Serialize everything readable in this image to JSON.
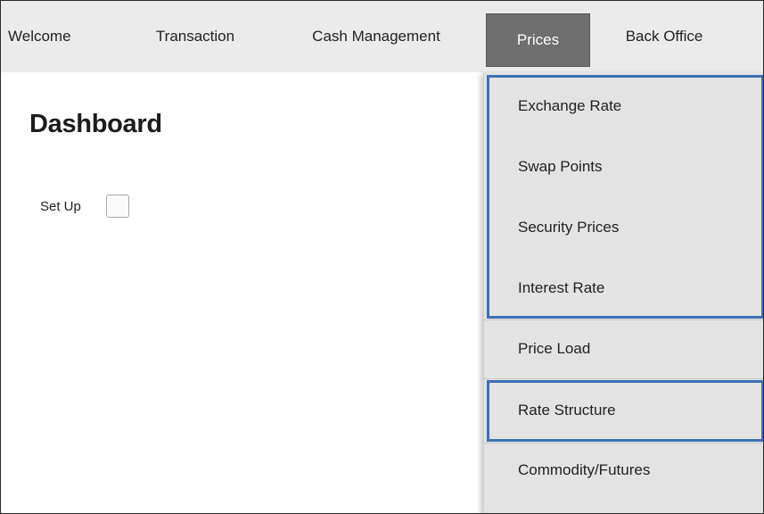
{
  "nav": {
    "items": [
      {
        "label": "Welcome"
      },
      {
        "label": "Transaction"
      },
      {
        "label": "Cash Management"
      },
      {
        "label": "Prices",
        "active": true
      },
      {
        "label": "Back Office"
      }
    ]
  },
  "main": {
    "title": "Dashboard",
    "setup_label": "Set Up",
    "setup_checked": false
  },
  "prices_menu": {
    "items": [
      {
        "label": "Exchange Rate"
      },
      {
        "label": "Swap Points"
      },
      {
        "label": "Security Prices"
      },
      {
        "label": "Interest Rate"
      },
      {
        "label": "Price Load"
      },
      {
        "label": "Rate Structure"
      },
      {
        "label": "Commodity/Futures"
      }
    ]
  },
  "colors": {
    "active_tab": "#6e6e6e",
    "highlight_border": "#3f6fb3",
    "topbar": "#ebebeb",
    "menu_bg": "#e3e3e3"
  }
}
